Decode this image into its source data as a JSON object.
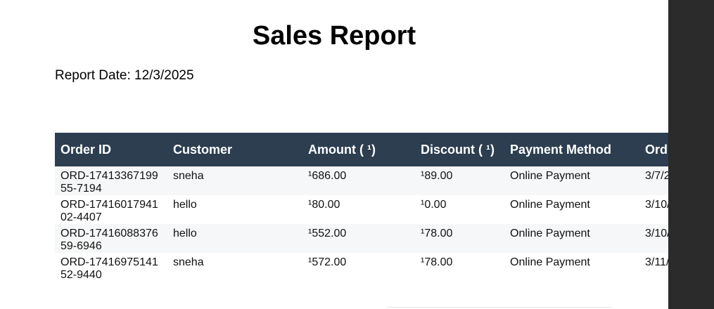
{
  "document": {
    "title": "Sales Report",
    "report_date": "Report Date: 12/3/2025"
  },
  "table": {
    "headers": [
      "Order ID",
      "Customer",
      "Amount ( ¹)",
      "Discount ( ¹)",
      "Payment Method",
      "Ord"
    ],
    "rows": [
      {
        "order_id_1": "ORD-17413367199",
        "order_id_2": "55-7194",
        "customer": "sneha",
        "amount": "¹686.00",
        "discount": "¹89.00",
        "payment": "Online Payment",
        "order_date": "3/7/2"
      },
      {
        "order_id_1": "ORD-17416017941",
        "order_id_2": "02-4407",
        "customer": "hello",
        "amount": "¹80.00",
        "discount": "¹0.00",
        "payment": "Online Payment",
        "order_date": "3/10/"
      },
      {
        "order_id_1": "ORD-17416088376",
        "order_id_2": "59-6946",
        "customer": "hello",
        "amount": "¹552.00",
        "discount": "¹78.00",
        "payment": "Online Payment",
        "order_date": "3/10/"
      },
      {
        "order_id_1": "ORD-17416975141",
        "order_id_2": "52-9440",
        "customer": "sneha",
        "amount": "¹572.00",
        "discount": "¹78.00",
        "payment": "Online Payment",
        "order_date": "3/11/"
      }
    ]
  },
  "colors": {
    "header_background": "#2c3e50",
    "header_text": "#ffffff",
    "striped_row": "#f6f7f8",
    "side_panel": "#2b2b2b"
  }
}
